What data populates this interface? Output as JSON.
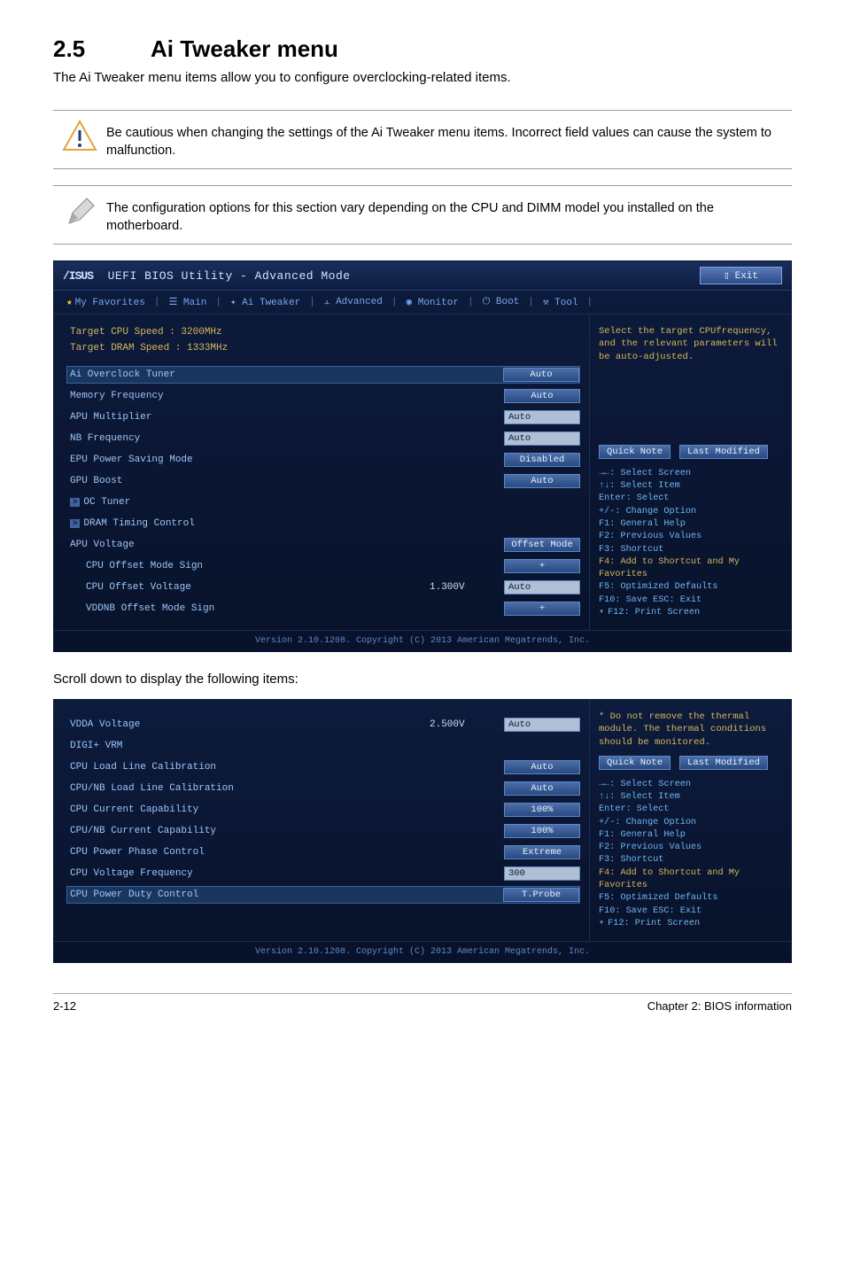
{
  "page": {
    "section_number": "2.5",
    "section_title": "Ai Tweaker menu",
    "intro": "The Ai Tweaker menu items allow you to configure overclocking-related items.",
    "note_caution": "Be cautious when changing the settings of the Ai Tweaker menu items. Incorrect field values can cause the system to malfunction.",
    "note_info": "The configuration options for this section vary depending on the CPU and DIMM model you installed on the motherboard.",
    "scroll_note": "Scroll down to display the following items:",
    "footer_left": "2-12",
    "footer_right": "Chapter 2: BIOS information"
  },
  "bios": {
    "brand_part1": "UEFI BIOS Utility - Advanced Mode",
    "exit": "Exit",
    "tabs": {
      "fav": "My Favorites",
      "main": "Main",
      "ai": "Ai Tweaker",
      "adv": "Advanced",
      "mon": "Monitor",
      "boot": "Boot",
      "tool": "Tool"
    },
    "footer": "Version 2.10.1208. Copyright (C) 2013 American Megatrends, Inc."
  },
  "screen1": {
    "target_cpu": "Target CPU Speed : 3200MHz",
    "target_dram": "Target DRAM Speed : 1333MHz",
    "rows": {
      "ai_overclock": {
        "label": "Ai Overclock Tuner",
        "value": "Auto"
      },
      "mem_freq": {
        "label": "Memory Frequency",
        "value": "Auto"
      },
      "apu_mult": {
        "label": "APU Multiplier",
        "value": "Auto"
      },
      "nb_freq": {
        "label": "NB Frequency",
        "value": "Auto"
      },
      "epu": {
        "label": "EPU Power Saving Mode",
        "value": "Disabled"
      },
      "gpu_boost": {
        "label": "GPU Boost",
        "value": "Auto"
      },
      "oc_tuner": {
        "label": "OC Tuner"
      },
      "dram_timing": {
        "label": "DRAM Timing Control"
      },
      "apu_voltage": {
        "label": "APU Voltage",
        "value": "Offset Mode"
      },
      "cpu_off_sign": {
        "label": "CPU Offset Mode Sign",
        "value": "+"
      },
      "cpu_off_volt": {
        "label": "CPU Offset Voltage",
        "mid": "1.300V",
        "value": "Auto"
      },
      "vddnb_sign": {
        "label": "VDDNB Offset Mode Sign",
        "value": "+"
      }
    },
    "help": "Select the target CPUfrequency, and the relevant parameters will be auto-adjusted."
  },
  "screen2": {
    "rows": {
      "vdda": {
        "label": "VDDA Voltage",
        "mid": "2.500V",
        "value": "Auto"
      },
      "digi": {
        "label": "DIGI+ VRM"
      },
      "cpu_llc": {
        "label": "CPU Load Line Calibration",
        "value": "Auto"
      },
      "cpunb_llc": {
        "label": "CPU/NB Load Line Calibration",
        "value": "Auto"
      },
      "cpu_cc": {
        "label": "CPU Current Capability",
        "value": "100%"
      },
      "cpunb_cc": {
        "label": "CPU/NB Current Capability",
        "value": "100%"
      },
      "cpu_ppc": {
        "label": "CPU Power Phase Control",
        "value": "Extreme"
      },
      "cpu_vf": {
        "label": "CPU Voltage Frequency",
        "value": "300"
      },
      "cpu_pdc": {
        "label": "CPU Power Duty Control",
        "value": "T.Probe"
      }
    },
    "help": "* Do not remove the thermal module. The thermal conditions should be monitored."
  },
  "right": {
    "quick_note": "Quick Note",
    "last_modified": "Last Modified",
    "k1": "→←: Select Screen",
    "k2": "↑↓: Select Item",
    "k3": "Enter: Select",
    "k4": "+/-: Change Option",
    "k5": "F1: General Help",
    "k6": "F2: Previous Values",
    "k7": "F3: Shortcut",
    "k8": "F4: Add to Shortcut and My Favorites",
    "k9": "F5: Optimized Defaults",
    "k10": "F10: Save  ESC: Exit",
    "k11": "F12: Print Screen"
  }
}
